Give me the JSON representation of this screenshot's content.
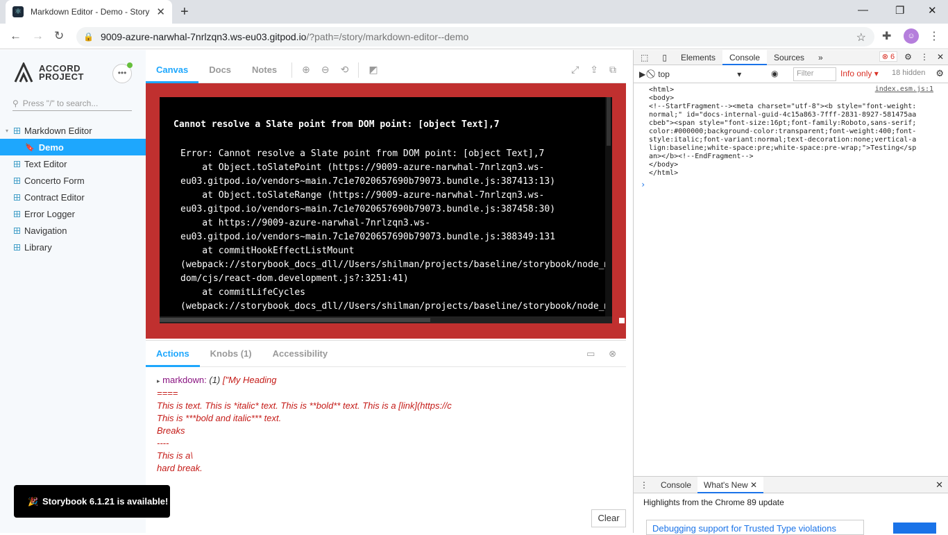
{
  "browser": {
    "tab_title": "Markdown Editor - Demo - Story",
    "url_host": "9009-azure-narwhal-7nrlzqn3.ws-eu03.gitpod.io",
    "url_path": "/?path=/story/markdown-editor--demo"
  },
  "sidebar": {
    "logo_line1": "ACCORD",
    "logo_line2": "PROJECT",
    "search_placeholder": "Press \"/\" to search...",
    "items": [
      {
        "label": "Markdown Editor"
      },
      {
        "label": "Demo"
      },
      {
        "label": "Text Editor"
      },
      {
        "label": "Concerto Form"
      },
      {
        "label": "Contract Editor"
      },
      {
        "label": "Error Logger"
      },
      {
        "label": "Navigation"
      },
      {
        "label": "Library"
      }
    ]
  },
  "toolbar": {
    "tabs": [
      "Canvas",
      "Docs",
      "Notes"
    ]
  },
  "error": {
    "title": "Cannot resolve a Slate point from DOM point: [object Text],7",
    "stack_lines": [
      "Error: Cannot resolve a Slate point from DOM point: [object Text],7",
      "    at Object.toSlatePoint (https://9009-azure-narwhal-7nrlzqn3.ws-",
      "eu03.gitpod.io/vendors~main.7c1e7020657690b79073.bundle.js:387413:13)",
      "    at Object.toSlateRange (https://9009-azure-narwhal-7nrlzqn3.ws-",
      "eu03.gitpod.io/vendors~main.7c1e7020657690b79073.bundle.js:387458:30)",
      "    at https://9009-azure-narwhal-7nrlzqn3.ws-",
      "eu03.gitpod.io/vendors~main.7c1e7020657690b79073.bundle.js:388349:131",
      "    at commitHookEffectListMount",
      "(webpack://storybook_docs_dll//Users/shilman/projects/baseline/storybook/node_mo",
      "dom/cjs/react-dom.development.js?:3251:41)",
      "    at commitLifeCycles",
      "(webpack://storybook_docs_dll//Users/shilman/projects/baseline/storybook/node_mo"
    ]
  },
  "addons": {
    "tabs": [
      "Actions",
      "Knobs (1)",
      "Accessibility"
    ],
    "log_key": "markdown:",
    "log_count": "(1)",
    "log_lines": [
      "[\"My Heading",
      "====",
      "",
      "This is text. This is *italic* text. This is **bold** text. This is a [link](https://c",
      "",
      "This is ***bold and italic*** text.",
      "",
      "Breaks",
      "----",
      "",
      "This is a\\",
      "hard break."
    ],
    "clear_label": "Clear"
  },
  "toast": {
    "emoji": "🎉",
    "text": "Storybook 6.1.21 is available!"
  },
  "devtools": {
    "tabs": [
      "Elements",
      "Console",
      "Sources"
    ],
    "error_count": "6",
    "context": "top",
    "filter_placeholder": "Filter",
    "level": "Info only ▾",
    "hidden": "18 hidden",
    "source_link": "index.esm.js:1",
    "console_html": "<html>\n<body>\n<!--StartFragment--><meta charset=\"utf-8\"><b style=\"font-weight:normal;\" id=\"docs-internal-guid-4c15a863-7fff-2831-8927-581475aacbeb\"><span style=\"font-size:16pt;font-family:Roboto,sans-serif;color:#000000;background-color:transparent;font-weight:400;font-style:italic;font-variant:normal;text-decoration:none;vertical-align:baseline;white-space:pre;white-space:pre-wrap;\">Testing</span></b><!--EndFragment-->\n</body>\n</html>",
    "drawer_tabs": [
      "Console",
      "What's New"
    ],
    "highlights": "Highlights from the Chrome 89 update",
    "link": "Debugging support for Trusted Type violations"
  }
}
